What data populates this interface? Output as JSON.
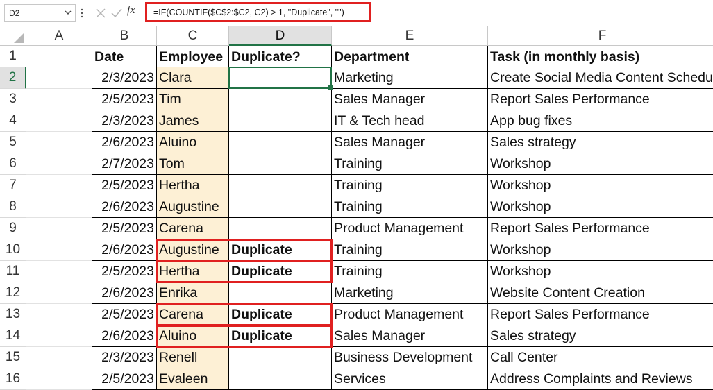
{
  "formula_bar": {
    "name_box": "D2",
    "fx_label": "fx",
    "formula": "=IF(COUNTIF($C$2:$C2, C2) > 1, \"Duplicate\", \"\")"
  },
  "columns": [
    "A",
    "B",
    "C",
    "D",
    "E",
    "F"
  ],
  "rows": [
    {
      "num": "1",
      "date": "Date",
      "employee": "Employee",
      "dup": "Duplicate?",
      "dept": "Department",
      "task": "Task (in monthly basis)"
    },
    {
      "num": "2",
      "date": "2/3/2023",
      "employee": "Clara",
      "dup": "",
      "dept": "Marketing",
      "task": "Create Social Media Content Schedule"
    },
    {
      "num": "3",
      "date": "2/5/2023",
      "employee": "Tim",
      "dup": "",
      "dept": "Sales Manager",
      "task": "Report Sales Performance"
    },
    {
      "num": "4",
      "date": "2/3/2023",
      "employee": "James",
      "dup": "",
      "dept": "IT & Tech head",
      "task": "App bug fixes"
    },
    {
      "num": "5",
      "date": "2/6/2023",
      "employee": "Aluino",
      "dup": "",
      "dept": "Sales Manager",
      "task": "Sales strategy"
    },
    {
      "num": "6",
      "date": "2/7/2023",
      "employee": "Tom",
      "dup": "",
      "dept": "Training",
      "task": "Workshop"
    },
    {
      "num": "7",
      "date": "2/5/2023",
      "employee": "Hertha",
      "dup": "",
      "dept": "Training",
      "task": "Workshop"
    },
    {
      "num": "8",
      "date": "2/6/2023",
      "employee": "Augustine",
      "dup": "",
      "dept": "Training",
      "task": "Workshop"
    },
    {
      "num": "9",
      "date": "2/5/2023",
      "employee": "Carena",
      "dup": "",
      "dept": "Product Management",
      "task": "Report Sales Performance"
    },
    {
      "num": "10",
      "date": "2/6/2023",
      "employee": "Augustine",
      "dup": "Duplicate",
      "dept": "Training",
      "task": "Workshop"
    },
    {
      "num": "11",
      "date": "2/5/2023",
      "employee": "Hertha",
      "dup": "Duplicate",
      "dept": "Training",
      "task": "Workshop"
    },
    {
      "num": "12",
      "date": "2/6/2023",
      "employee": "Enrika",
      "dup": "",
      "dept": "Marketing",
      "task": "Website Content Creation"
    },
    {
      "num": "13",
      "date": "2/5/2023",
      "employee": "Carena",
      "dup": "Duplicate",
      "dept": "Product Management",
      "task": "Report Sales Performance"
    },
    {
      "num": "14",
      "date": "2/6/2023",
      "employee": "Aluino",
      "dup": "Duplicate",
      "dept": "Sales Manager",
      "task": "Sales strategy"
    },
    {
      "num": "15",
      "date": "2/3/2023",
      "employee": "Renell",
      "dup": "",
      "dept": "Business Development",
      "task": "Call Center"
    },
    {
      "num": "16",
      "date": "2/5/2023",
      "employee": "Evaleen",
      "dup": "",
      "dept": "Services",
      "task": "Address Complaints and Reviews"
    }
  ],
  "selected_cell": "D2",
  "highlight_color": "#e02020",
  "accent_color": "#217346",
  "employee_fill": "#fdf0d5"
}
